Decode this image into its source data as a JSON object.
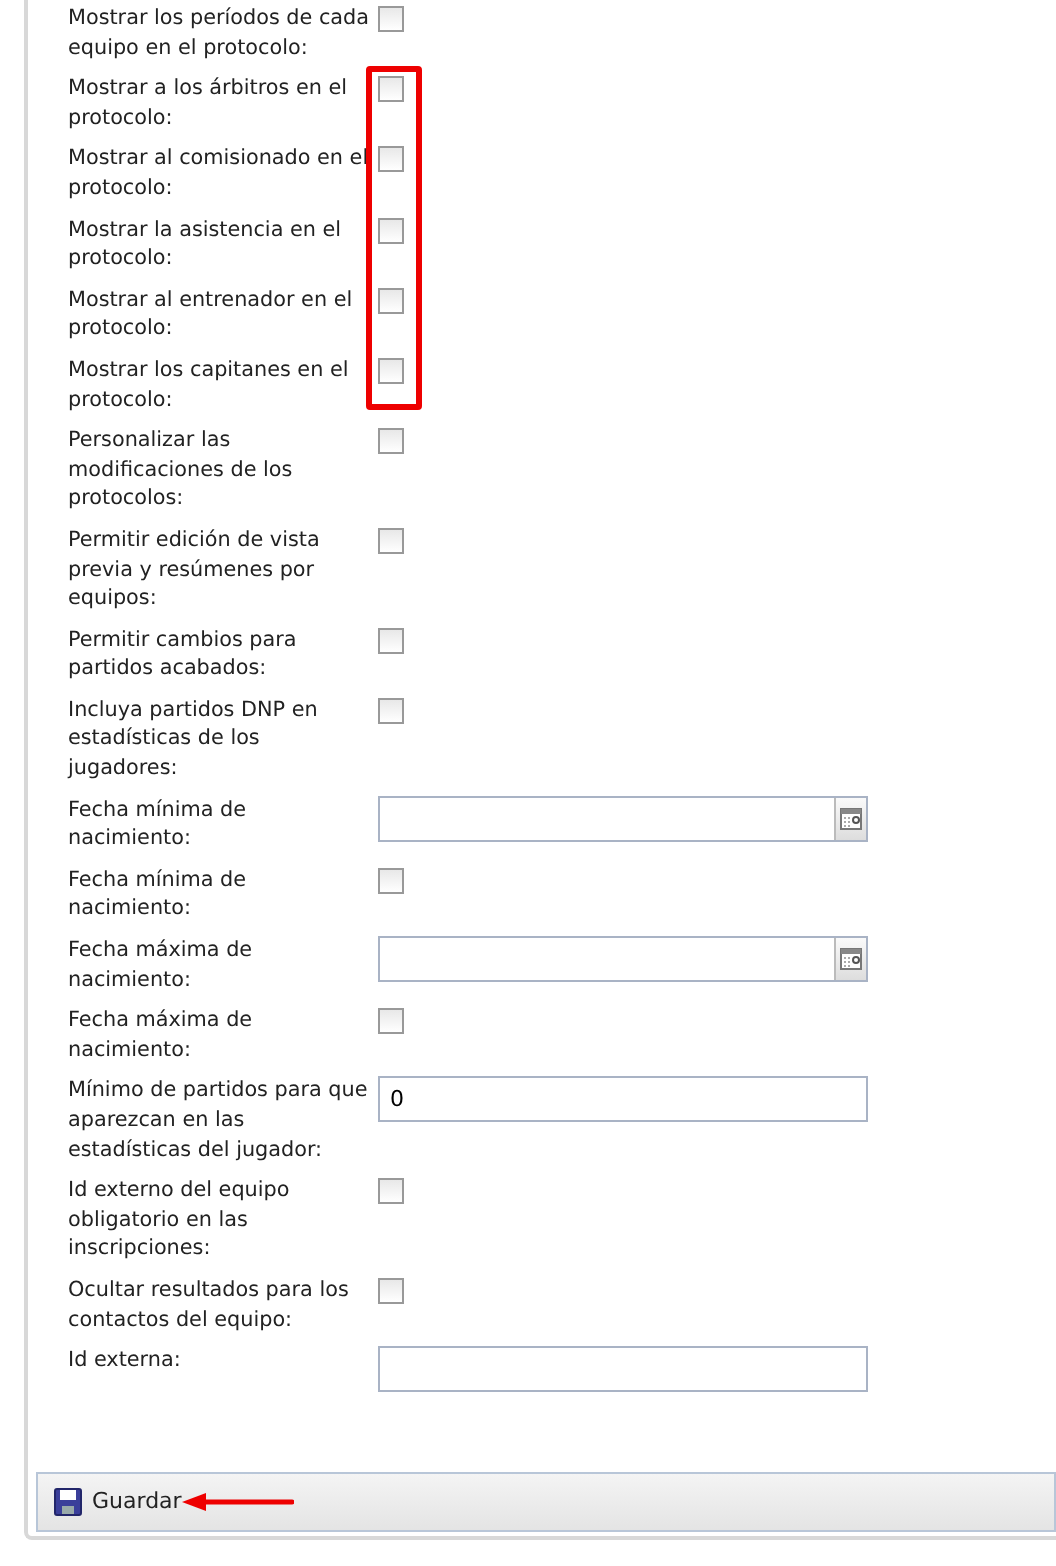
{
  "rows": [
    {
      "kind": "checkbox",
      "label": "Mostrar los períodos de cada equipo en el protocolo:",
      "checked": false,
      "highlighted": false
    },
    {
      "kind": "checkbox",
      "label": "Mostrar a los árbitros en el protocolo:",
      "checked": false,
      "highlighted": true
    },
    {
      "kind": "checkbox",
      "label": "Mostrar al comisionado en el protocolo:",
      "checked": false,
      "highlighted": true
    },
    {
      "kind": "checkbox",
      "label": "Mostrar la asistencia en el protocolo:",
      "checked": false,
      "highlighted": true
    },
    {
      "kind": "checkbox",
      "label": "Mostrar al entrenador en el protocolo:",
      "checked": false,
      "highlighted": true
    },
    {
      "kind": "checkbox",
      "label": "Mostrar los capitanes en el protocolo:",
      "checked": false,
      "highlighted": true
    },
    {
      "kind": "checkbox",
      "label": "Personalizar las modificaciones de los protocolos:",
      "checked": false,
      "highlighted": false
    },
    {
      "kind": "checkbox",
      "label": "Permitir edición de vista previa y resúmenes por equipos:",
      "checked": false,
      "highlighted": false
    },
    {
      "kind": "checkbox",
      "label": "Permitir cambios para partidos acabados:",
      "checked": false,
      "highlighted": false
    },
    {
      "kind": "checkbox",
      "label": "Incluya partidos DNP en estadísticas de los jugadores:",
      "checked": false,
      "highlighted": false
    },
    {
      "kind": "date",
      "label": "Fecha mínima de nacimiento:",
      "highlighted": false
    },
    {
      "kind": "checkbox",
      "label": "Fecha mínima de nacimiento:",
      "checked": false,
      "highlighted": false
    },
    {
      "kind": "date",
      "label": "Fecha máxima de nacimiento:",
      "highlighted": false
    },
    {
      "kind": "checkbox",
      "label": "Fecha máxima de nacimiento:",
      "checked": false,
      "highlighted": false
    },
    {
      "kind": "text",
      "label": "Mínimo de partidos para que aparezcan en las estadísticas del jugador:",
      "value": "0",
      "highlighted": false
    },
    {
      "kind": "checkbox",
      "label": "Id externo del equipo obligatorio en las inscripciones:",
      "checked": false,
      "highlighted": false
    },
    {
      "kind": "checkbox",
      "label": "Ocultar resultados para los contactos del equipo:",
      "checked": false,
      "highlighted": false
    },
    {
      "kind": "text",
      "label": "Id externa:",
      "highlighted": false
    }
  ],
  "toolbar": {
    "save_button": {
      "label": "Guardar",
      "pointed_arrow": true
    }
  }
}
